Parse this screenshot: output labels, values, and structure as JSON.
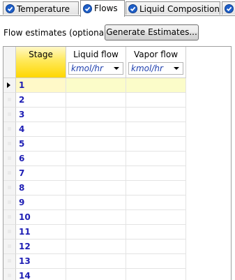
{
  "tabs": [
    {
      "label": "Temperature",
      "icon": "check-circle-icon",
      "active": false
    },
    {
      "label": "Flows",
      "icon": "check-circle-icon",
      "active": true
    },
    {
      "label": "Liquid Composition",
      "icon": "check-circle-icon",
      "active": false
    }
  ],
  "toolbar": {
    "flow_estimates_label": "Flow estimates (optional)",
    "generate_button": "Generate Estimates..."
  },
  "grid": {
    "columns": {
      "stage": "Stage",
      "liquid_flow": "Liquid flow",
      "vapor_flow": "Vapor flow"
    },
    "units": {
      "liquid_flow": "kmol/hr",
      "vapor_flow": "kmol/hr"
    },
    "rows": [
      "1",
      "2",
      "3",
      "4",
      "5",
      "6",
      "7",
      "8",
      "9",
      "10",
      "11",
      "12",
      "13",
      "14"
    ],
    "selected_row": "1"
  },
  "colors": {
    "stage_header": "#ffd700",
    "stage_text": "#1e1eb4",
    "check_icon": "#1f5fc8"
  }
}
